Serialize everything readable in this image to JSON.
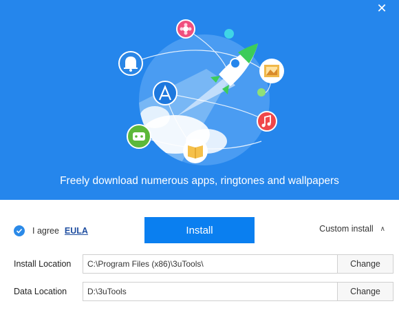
{
  "window": {
    "close_glyph": "✕"
  },
  "hero": {
    "background_color": "#2586ec",
    "tagline": "Freely download numerous apps, ringtones and wallpapers",
    "icons": [
      "flower-app-icon",
      "bell-icon",
      "app-store-icon",
      "rocket-icon",
      "photo-icon",
      "music-icon",
      "robot-icon",
      "book-icon"
    ]
  },
  "agree": {
    "checked": true,
    "label": "I agree",
    "link": "EULA"
  },
  "install_button": {
    "label": "Install",
    "color": "#0a7ff0"
  },
  "custom_install": {
    "label": "Custom install",
    "caret": "∧"
  },
  "install_location": {
    "label": "Install Location",
    "value": "C:\\Program Files (x86)\\3uTools\\",
    "button": "Change"
  },
  "data_location": {
    "label": "Data Location",
    "value": "D:\\3uTools",
    "button": "Change"
  }
}
